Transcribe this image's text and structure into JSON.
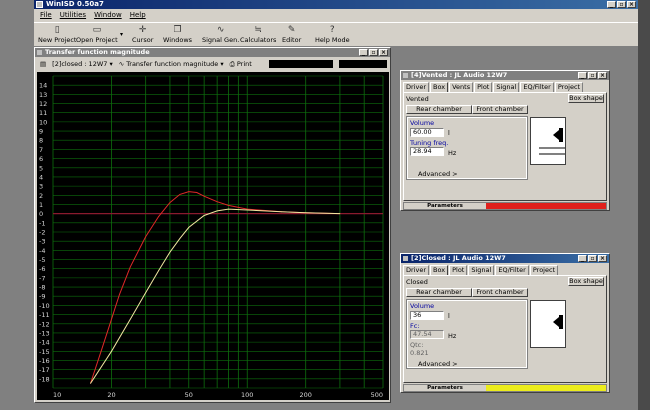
{
  "app": {
    "title": "WinISD 0.50a7",
    "menu": [
      "File",
      "Utilities",
      "Window",
      "Help"
    ],
    "toolbar": [
      {
        "label": "New Project",
        "icon": "new-project-icon",
        "glyph": "▯"
      },
      {
        "label": "Open Project",
        "icon": "open-project-icon",
        "glyph": "▭"
      },
      {
        "label": "Cursor",
        "icon": "cursor-icon",
        "glyph": "✛"
      },
      {
        "label": "Windows",
        "icon": "windows-icon",
        "glyph": "❐"
      },
      {
        "label": "Signal Gen.",
        "icon": "signal-gen-icon",
        "glyph": "∿"
      },
      {
        "label": "Calculators",
        "icon": "calculators-icon",
        "glyph": "≒"
      },
      {
        "label": "Editor",
        "icon": "editor-icon",
        "glyph": "✎"
      },
      {
        "label": "Help Mode",
        "icon": "help-mode-icon",
        "glyph": "?"
      }
    ]
  },
  "tf_window": {
    "title": "Transfer function magnitude",
    "project_select": "[2]closed : 12W7",
    "graph_select": "Transfer function magnitude",
    "print_label": "Print"
  },
  "vented_window": {
    "title": "[4]Vented : JL Audio 12W7",
    "tabs": [
      "Driver",
      "Box",
      "Vents",
      "Plot",
      "Signal",
      "EQ/Filter",
      "Project"
    ],
    "box_type": "Vented",
    "box_shape_label": "Box shape",
    "rear_label": "Rear chamber",
    "front_label": "Front chamber",
    "volume_label": "Volume",
    "volume_value": "60.00",
    "volume_unit": "l",
    "tuning_label": "Tuning freq.",
    "tuning_value": "28.94",
    "tuning_unit": "Hz",
    "advanced_label": "Advanced >",
    "status_label": "Parameters",
    "status_color": "#e0201c"
  },
  "closed_window": {
    "title": "[2]Closed : JL Audio 12W7",
    "tabs": [
      "Driver",
      "Box",
      "Plot",
      "Signal",
      "EQ/Filter",
      "Project"
    ],
    "box_type": "Closed",
    "box_shape_label": "Box shape",
    "rear_label": "Rear chamber",
    "front_label": "Front chamber",
    "volume_label": "Volume",
    "volume_value": "36",
    "volume_unit": "l",
    "fc_label": "Fc:",
    "fc_value": "47.54",
    "fc_unit": "Hz",
    "qtc_label": "Qtc:",
    "qtc_value": "0.821",
    "advanced_label": "Advanced >",
    "status_label": "Parameters",
    "status_color": "#ecec1c"
  },
  "chart_data": {
    "type": "line",
    "title": "",
    "xlabel": "",
    "ylabel": "",
    "xscale": "log",
    "xlim": [
      10,
      500
    ],
    "ylim": [
      -19,
      15
    ],
    "x_tick_labels": [
      "10",
      "20",
      "50",
      "100",
      "200",
      "500"
    ],
    "x_tick_values": [
      10,
      20,
      50,
      100,
      200,
      500
    ],
    "y_tick_labels": [
      "14",
      "13",
      "12",
      "11",
      "10",
      "9",
      "8",
      "7",
      "6",
      "5",
      "4",
      "3",
      "2",
      "1",
      "0",
      "-1",
      "-2",
      "-3",
      "-4",
      "-5",
      "-6",
      "-7",
      "-8",
      "-9",
      "-10",
      "-11",
      "-12",
      "-13",
      "-14",
      "-15",
      "-16",
      "-17",
      "-18"
    ],
    "background": "#000000",
    "grid_color": "#0d6e0d",
    "zero_line_color": "#8a1a2e",
    "series": [
      {
        "color": "#e02828",
        "x": [
          15.6,
          18,
          20,
          22,
          25,
          30,
          35,
          40,
          45,
          50,
          55,
          60,
          70,
          80,
          100,
          150,
          200,
          300
        ],
        "y": [
          -18.5,
          -14.5,
          -11.5,
          -8.8,
          -5.8,
          -2.5,
          -0.3,
          1.2,
          2.1,
          2.4,
          2.3,
          1.9,
          1.3,
          0.9,
          0.5,
          0.2,
          0.1,
          0.0
        ]
      },
      {
        "color": "#f0e6a0",
        "x": [
          15.6,
          20,
          25,
          30,
          35,
          40,
          45,
          50,
          60,
          70,
          80,
          100,
          150,
          200,
          300
        ],
        "y": [
          -18.5,
          -15,
          -11.5,
          -8.6,
          -6.2,
          -4.2,
          -2.7,
          -1.5,
          -0.2,
          0.3,
          0.5,
          0.4,
          0.2,
          0.1,
          0.0
        ]
      }
    ]
  }
}
